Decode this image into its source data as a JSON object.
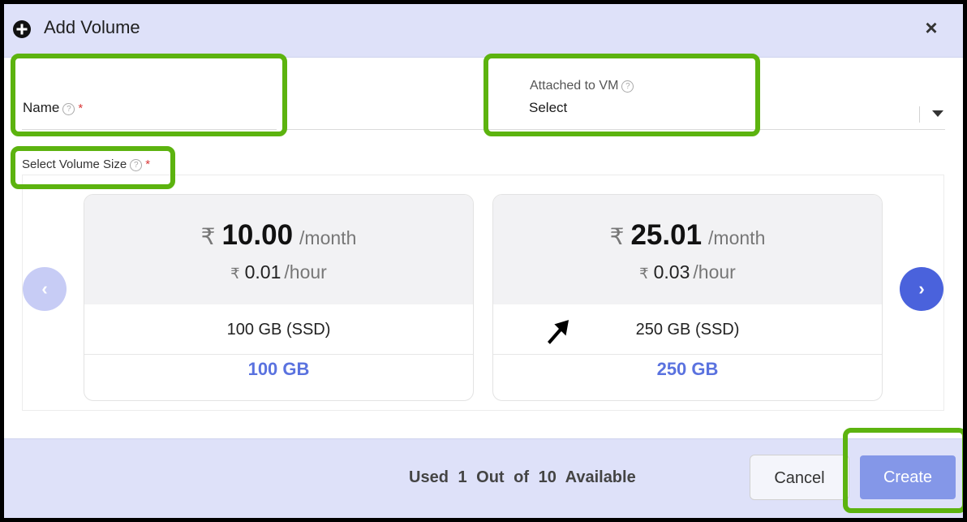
{
  "dialog": {
    "title": "Add Volume",
    "close_label": "×"
  },
  "form": {
    "name_label": "Name",
    "help_glyph": "?",
    "required_mark": "*",
    "attached_label": "Attached to VM",
    "attached_value": "Select",
    "size_label": "Select Volume Size"
  },
  "plans": [
    {
      "currency": "₹",
      "monthly_price": "10.00",
      "month_unit": "/month",
      "hourly_price": "0.01",
      "hour_unit": "/hour",
      "disk": "100 GB (SSD)",
      "size": "100 GB"
    },
    {
      "currency": "₹",
      "monthly_price": "25.01",
      "month_unit": "/month",
      "hourly_price": "0.03",
      "hour_unit": "/hour",
      "disk": "250 GB (SSD)",
      "size": "250 GB"
    }
  ],
  "carousel": {
    "prev_glyph": "‹",
    "next_glyph": "›"
  },
  "footer": {
    "usage_text": "Used 1 Out of 10 Available",
    "cancel_label": "Cancel",
    "create_label": "Create"
  },
  "colors": {
    "accent": "#4a62dc",
    "highlight": "#5cb30f",
    "size_text": "#5a72df"
  },
  "icons": {
    "header": "plus-circle-icon",
    "help": "question-circle-icon",
    "dropdown": "caret-down-icon",
    "cursor": "mouse-pointer-icon"
  }
}
